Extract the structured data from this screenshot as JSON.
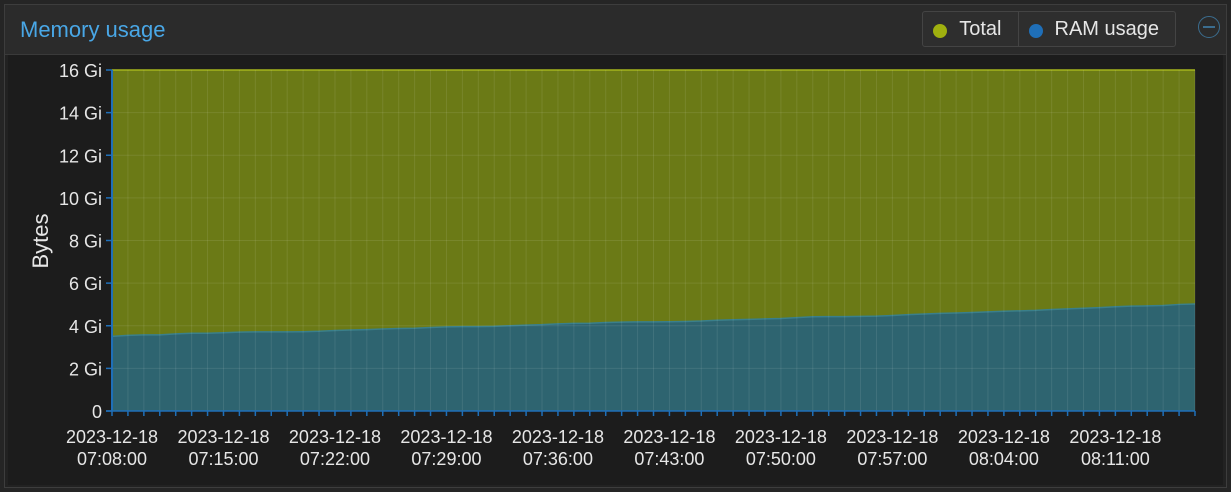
{
  "panel": {
    "title": "Memory usage"
  },
  "colors": {
    "total": "#9fb00f",
    "ram": "#1f6fb8",
    "total_fill": "#6b7a16",
    "ram_fill": "#2e6470",
    "title": "#49a7e6"
  },
  "icons": {
    "collapse": "minus-circle-icon"
  },
  "chart_data": {
    "type": "area",
    "ylabel": "Bytes",
    "ylim": [
      0,
      16
    ],
    "yticks": [
      {
        "value": 0,
        "label": "0"
      },
      {
        "value": 2,
        "label": "2 Gi"
      },
      {
        "value": 4,
        "label": "4 Gi"
      },
      {
        "value": 6,
        "label": "6 Gi"
      },
      {
        "value": 8,
        "label": "8 Gi"
      },
      {
        "value": 10,
        "label": "10 Gi"
      },
      {
        "value": 12,
        "label": "12 Gi"
      },
      {
        "value": 14,
        "label": "14 Gi"
      },
      {
        "value": 16,
        "label": "16 Gi"
      }
    ],
    "xlim": [
      "2023-12-18 07:08:00",
      "2023-12-18 08:16:00"
    ],
    "xticks": [
      {
        "time": "07:08:00",
        "date": "2023-12-18"
      },
      {
        "time": "07:15:00",
        "date": "2023-12-18"
      },
      {
        "time": "07:22:00",
        "date": "2023-12-18"
      },
      {
        "time": "07:29:00",
        "date": "2023-12-18"
      },
      {
        "time": "07:36:00",
        "date": "2023-12-18"
      },
      {
        "time": "07:43:00",
        "date": "2023-12-18"
      },
      {
        "time": "07:50:00",
        "date": "2023-12-18"
      },
      {
        "time": "07:57:00",
        "date": "2023-12-18"
      },
      {
        "time": "08:04:00",
        "date": "2023-12-18"
      },
      {
        "time": "08:11:00",
        "date": "2023-12-18"
      }
    ],
    "series": [
      {
        "name": "Total",
        "points": [
          [
            "07:08:00",
            16
          ],
          [
            "08:16:00",
            16
          ]
        ]
      },
      {
        "name": "RAM usage",
        "points": [
          [
            "07:08:00",
            3.5
          ],
          [
            "07:09:00",
            3.55
          ],
          [
            "07:10:00",
            3.57
          ],
          [
            "07:11:00",
            3.57
          ],
          [
            "07:12:00",
            3.62
          ],
          [
            "07:13:00",
            3.65
          ],
          [
            "07:14:00",
            3.65
          ],
          [
            "07:15:00",
            3.67
          ],
          [
            "07:16:00",
            3.7
          ],
          [
            "07:17:00",
            3.71
          ],
          [
            "07:18:00",
            3.71
          ],
          [
            "07:19:00",
            3.71
          ],
          [
            "07:20:00",
            3.72
          ],
          [
            "07:21:00",
            3.74
          ],
          [
            "07:22:00",
            3.78
          ],
          [
            "07:23:00",
            3.8
          ],
          [
            "07:24:00",
            3.82
          ],
          [
            "07:25:00",
            3.85
          ],
          [
            "07:26:00",
            3.87
          ],
          [
            "07:27:00",
            3.88
          ],
          [
            "07:28:00",
            3.92
          ],
          [
            "07:29:00",
            3.95
          ],
          [
            "07:30:00",
            3.96
          ],
          [
            "07:31:00",
            3.96
          ],
          [
            "07:32:00",
            3.97
          ],
          [
            "07:33:00",
            4.0
          ],
          [
            "07:34:00",
            4.03
          ],
          [
            "07:35:00",
            4.05
          ],
          [
            "07:36:00",
            4.09
          ],
          [
            "07:37:00",
            4.11
          ],
          [
            "07:38:00",
            4.12
          ],
          [
            "07:39:00",
            4.15
          ],
          [
            "07:40:00",
            4.17
          ],
          [
            "07:41:00",
            4.18
          ],
          [
            "07:42:00",
            4.18
          ],
          [
            "07:43:00",
            4.19
          ],
          [
            "07:44:00",
            4.2
          ],
          [
            "07:45:00",
            4.22
          ],
          [
            "07:46:00",
            4.26
          ],
          [
            "07:47:00",
            4.28
          ],
          [
            "07:48:00",
            4.3
          ],
          [
            "07:49:00",
            4.32
          ],
          [
            "07:50:00",
            4.34
          ],
          [
            "07:51:00",
            4.38
          ],
          [
            "07:52:00",
            4.42
          ],
          [
            "07:53:00",
            4.43
          ],
          [
            "07:54:00",
            4.43
          ],
          [
            "07:55:00",
            4.44
          ],
          [
            "07:56:00",
            4.45
          ],
          [
            "07:57:00",
            4.48
          ],
          [
            "07:58:00",
            4.52
          ],
          [
            "07:59:00",
            4.55
          ],
          [
            "08:00:00",
            4.58
          ],
          [
            "08:01:00",
            4.6
          ],
          [
            "08:02:00",
            4.62
          ],
          [
            "08:03:00",
            4.65
          ],
          [
            "08:04:00",
            4.68
          ],
          [
            "08:05:00",
            4.7
          ],
          [
            "08:06:00",
            4.72
          ],
          [
            "08:07:00",
            4.76
          ],
          [
            "08:08:00",
            4.79
          ],
          [
            "08:09:00",
            4.82
          ],
          [
            "08:10:00",
            4.85
          ],
          [
            "08:11:00",
            4.89
          ],
          [
            "08:12:00",
            4.92
          ],
          [
            "08:13:00",
            4.93
          ],
          [
            "08:14:00",
            4.95
          ],
          [
            "08:15:00",
            5.0
          ],
          [
            "08:16:00",
            5.02
          ]
        ]
      }
    ],
    "grid": true,
    "legend_position": "top-right"
  }
}
